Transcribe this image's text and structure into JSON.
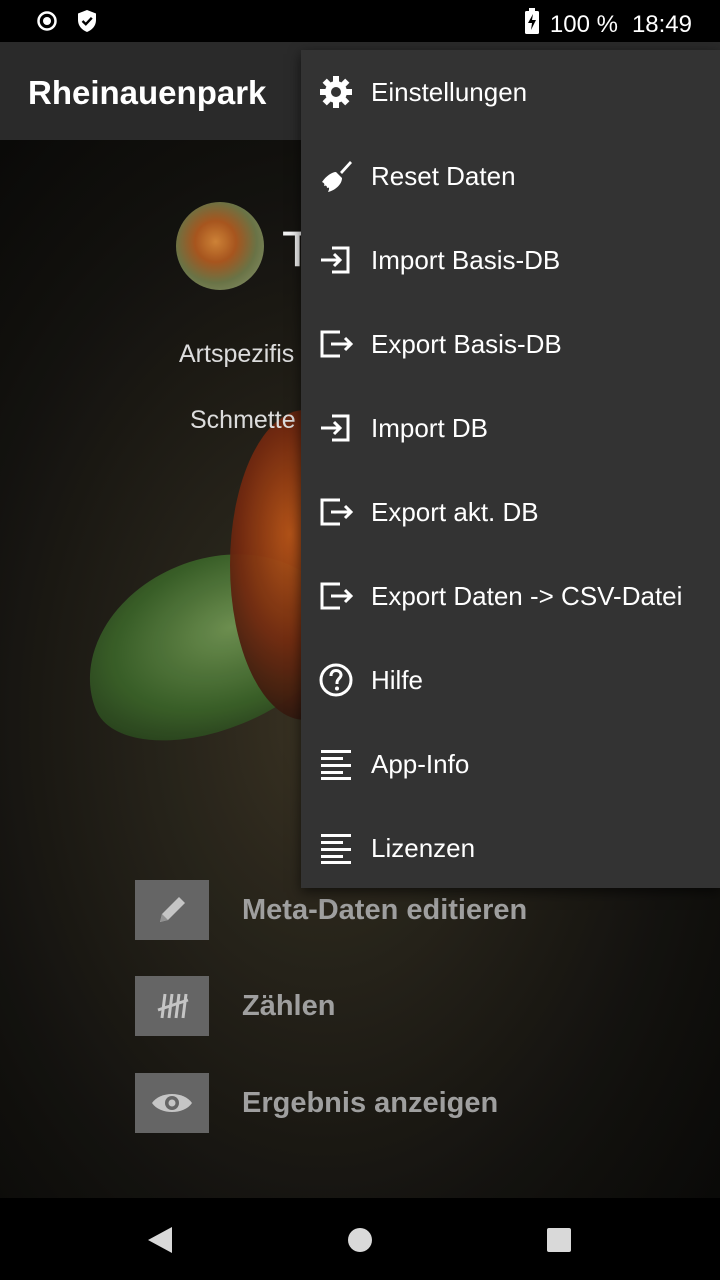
{
  "status_bar": {
    "battery": "100 %",
    "time": "18:49",
    "left_icons": [
      "record-icon",
      "shield-check-icon"
    ],
    "battery_icon": "battery-charging-icon"
  },
  "app_bar": {
    "title": "Rheinauenpark"
  },
  "background": {
    "title_partial": "T",
    "line1_partial": "Artspezifis",
    "line2_partial": "Schmette",
    "actions": [
      {
        "label": "Meta-Daten editieren",
        "icon": "pencil-icon"
      },
      {
        "label": "Zählen",
        "icon": "tally-icon"
      },
      {
        "label": "Ergebnis anzeigen",
        "icon": "eye-icon"
      }
    ]
  },
  "menu": {
    "items": [
      {
        "label": "Einstellungen",
        "icon": "gear-icon"
      },
      {
        "label": "Reset Daten",
        "icon": "broom-icon"
      },
      {
        "label": "Import Basis-DB",
        "icon": "import-icon"
      },
      {
        "label": "Export Basis-DB",
        "icon": "export-icon"
      },
      {
        "label": "Import DB",
        "icon": "import-icon"
      },
      {
        "label": "Export akt. DB",
        "icon": "export-icon"
      },
      {
        "label": "Export Daten -> CSV-Datei",
        "icon": "export-icon"
      },
      {
        "label": "Hilfe",
        "icon": "help-circle-icon"
      },
      {
        "label": "App-Info",
        "icon": "text-lines-icon"
      },
      {
        "label": "Lizenzen",
        "icon": "text-lines-icon"
      }
    ]
  },
  "nav_bar": {
    "buttons": [
      "back-icon",
      "home-icon",
      "recents-icon"
    ]
  }
}
